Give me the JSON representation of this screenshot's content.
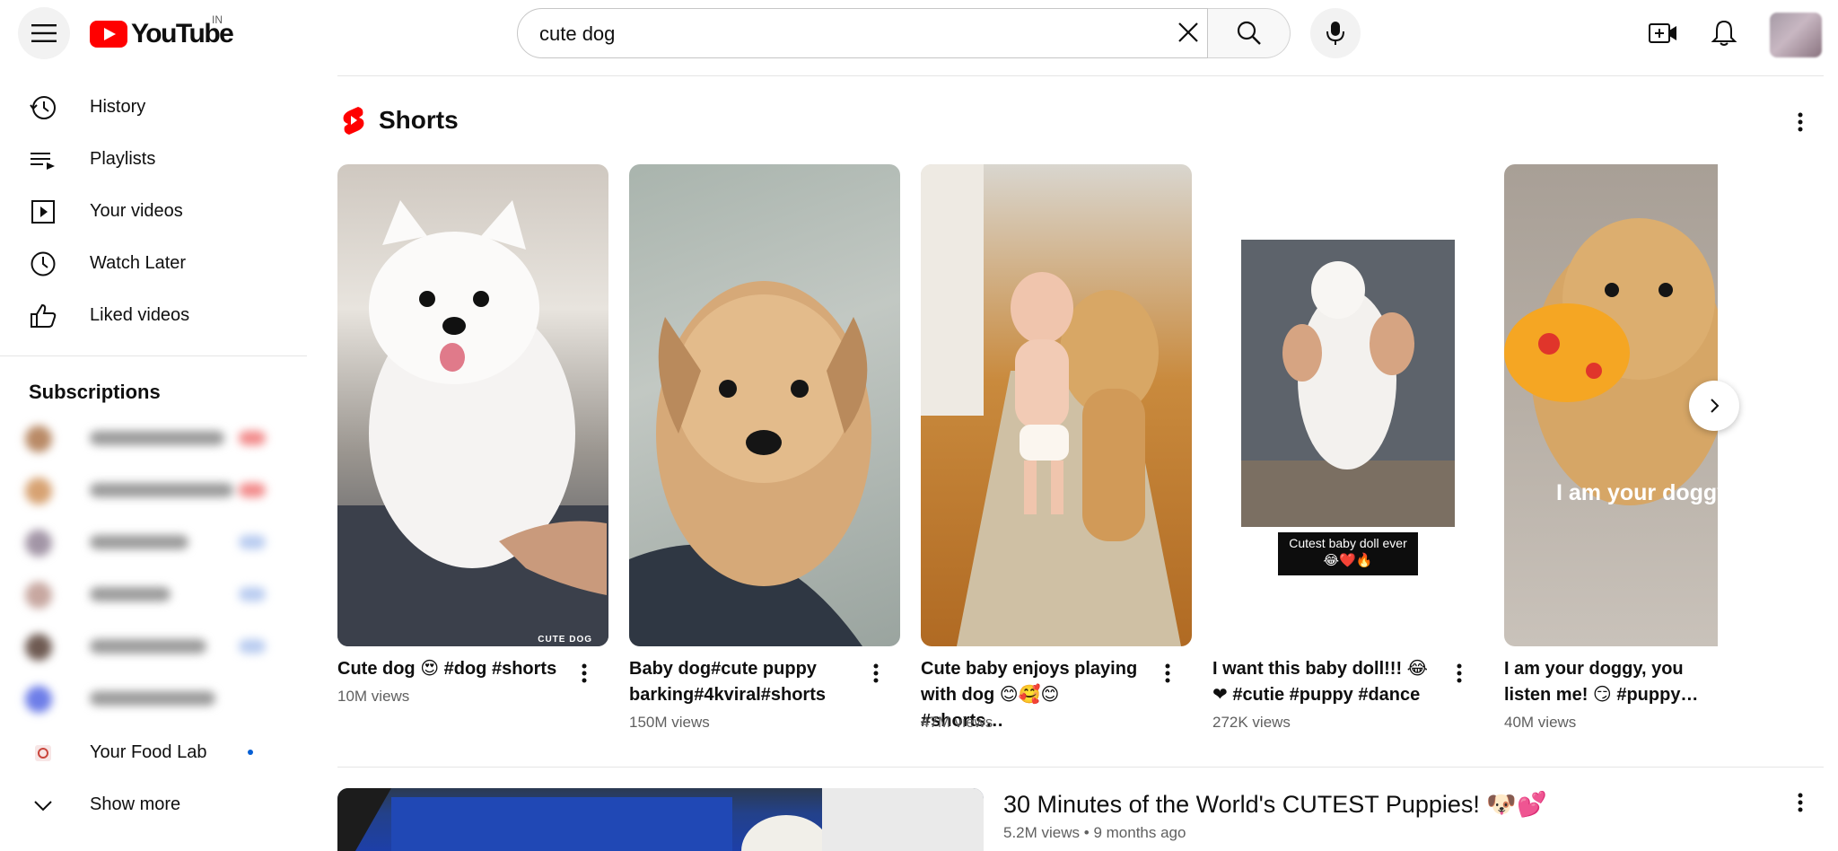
{
  "header": {
    "logo_text": "YouTube",
    "region": "IN",
    "search_value": "cute dog",
    "search_placeholder": "Search"
  },
  "sidebar": {
    "items": [
      {
        "label": "History",
        "icon": "history-icon"
      },
      {
        "label": "Playlists",
        "icon": "playlists-icon"
      },
      {
        "label": "Your videos",
        "icon": "your-videos-icon"
      },
      {
        "label": "Watch Later",
        "icon": "watch-later-icon"
      },
      {
        "label": "Liked videos",
        "icon": "like-icon"
      }
    ],
    "subscriptions_title": "Subscriptions",
    "food_lab_label": "Your Food Lab",
    "show_more_label": "Show more"
  },
  "shorts": {
    "title": "Shorts",
    "items": [
      {
        "title": "Cute dog 😍 #dog #shorts",
        "views": "10M views",
        "overlay": "CUTE DOG"
      },
      {
        "title": "Baby dog#cute puppy barking#4kviral#shorts",
        "views": "150M views"
      },
      {
        "title": "Cute baby enjoys playing with dog 😊🥰😊 #shorts…",
        "views": "47M views"
      },
      {
        "title": "I want this baby doll!!! 😂❤ #cutie #puppy #dance",
        "views": "272K views",
        "overlay": "Cutest baby doll ever",
        "overlay_emoji": "😂❤️🔥"
      },
      {
        "title": "I am your doggy, you listen me! 😏 #puppy…",
        "views": "40M views",
        "overlay": "I am your doggy!"
      }
    ]
  },
  "video": {
    "title": "30 Minutes of the World's CUTEST Puppies! 🐶💕",
    "views": "5.2M views",
    "age": "9 months ago"
  },
  "colors": {
    "brand_red": "#ff0000",
    "text_primary": "#0f0f0f",
    "text_secondary": "#606060",
    "subscription_dot": "#065fd4"
  }
}
